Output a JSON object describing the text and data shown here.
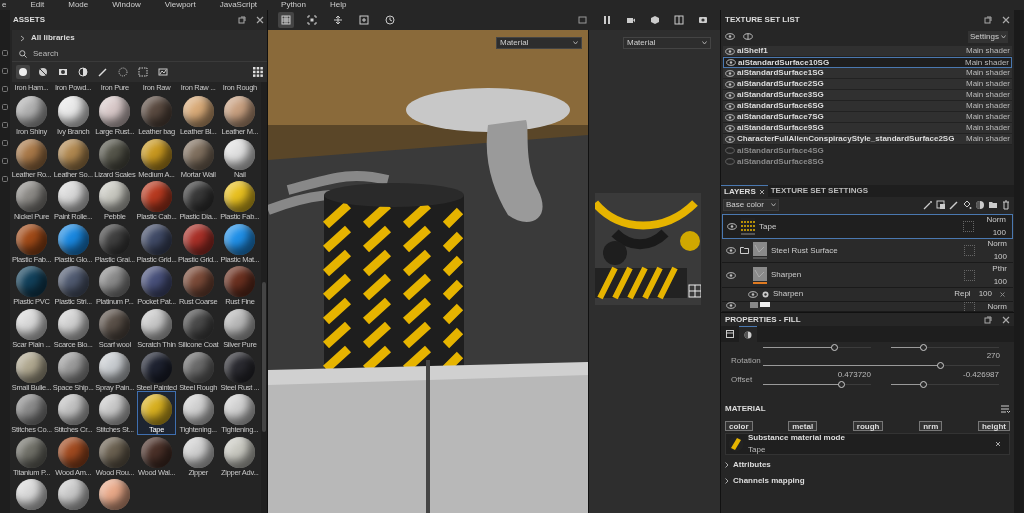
{
  "menu_bar": [
    "e",
    "Edit",
    "Mode",
    "Window",
    "Viewport",
    "JavaScript",
    "Python",
    "Help"
  ],
  "assets": {
    "title": "ASSETS",
    "library": "All libraries",
    "search": {
      "placeholder": "Search"
    },
    "filters": [
      {
        "selected": true
      },
      {
        "selected": false
      },
      {
        "selected": false
      },
      {
        "selected": false
      },
      {
        "selected": false
      },
      {
        "selected": false
      },
      {
        "selected": false
      },
      {
        "selected": false
      }
    ],
    "items": [
      {
        "name": "Iron Ham...",
        "selected": false
      },
      {
        "name": "Iron Powd...",
        "selected": false
      },
      {
        "name": "Iron Pure",
        "selected": false
      },
      {
        "name": "Iron Raw",
        "selected": false
      },
      {
        "name": "Iron Raw ...",
        "selected": false
      },
      {
        "name": "Iron Rough",
        "selected": false
      },
      {
        "name": "Iron Shiny",
        "color": "#b0b0b0",
        "selected": false
      },
      {
        "name": "Ivy Branch",
        "color": "#e8e8e8",
        "selected": false
      },
      {
        "name": "Large Rust...",
        "color": "#d8c8c8",
        "selected": false
      },
      {
        "name": "Leather bag",
        "color": "#5a4a40",
        "selected": false
      },
      {
        "name": "Leather Bl...",
        "color": "#d8aa78",
        "selected": false
      },
      {
        "name": "Leather M...",
        "color": "#c8a080",
        "selected": false
      },
      {
        "name": "Leather Ro...",
        "color": "#a87848",
        "selected": false
      },
      {
        "name": "Leather So...",
        "color": "#b08850",
        "selected": false
      },
      {
        "name": "Lizard Scales",
        "color": "#55554a",
        "selected": false
      },
      {
        "name": "Medium A...",
        "color": "#c89820",
        "selected": false
      },
      {
        "name": "Mortar Wall",
        "color": "#80705f",
        "selected": false
      },
      {
        "name": "Nail",
        "color": "#e0e0e0",
        "selected": false
      },
      {
        "name": "Nickel Pure",
        "color": "#8c8a86",
        "selected": false
      },
      {
        "name": "Paint Rolle...",
        "color": "#d8d8d8",
        "selected": false
      },
      {
        "name": "Pebble",
        "color": "#c8c8c0",
        "selected": false
      },
      {
        "name": "Plastic Cab...",
        "color": "#b83a20",
        "selected": false
      },
      {
        "name": "Plastic Dia...",
        "color": "#383838",
        "selected": false
      },
      {
        "name": "Plastic Fab...",
        "color": "#e8c020",
        "selected": false
      },
      {
        "name": "Plastic Fab...",
        "color": "#a04a18",
        "selected": false
      },
      {
        "name": "Plastic Glo...",
        "color": "#1a88e0",
        "selected": false
      },
      {
        "name": "Plastic Grai...",
        "color": "#404040",
        "selected": false
      },
      {
        "name": "Plastic Grid...",
        "color": "#404a66",
        "selected": false
      },
      {
        "name": "Plastic Grid...",
        "color": "#a83028",
        "selected": false
      },
      {
        "name": "Plastic Mat...",
        "color": "#2090e8",
        "selected": false
      },
      {
        "name": "Plastic PVC",
        "color": "#12405a",
        "selected": false
      },
      {
        "name": "Plastic Stri...",
        "color": "#505a70",
        "selected": false
      },
      {
        "name": "Platinum P...",
        "color": "#8a8a8a",
        "selected": false
      },
      {
        "name": "Pocket Pat...",
        "color": "#48507a",
        "selected": false
      },
      {
        "name": "Rust Coarse",
        "color": "#7a4a38",
        "selected": false
      },
      {
        "name": "Rust Fine",
        "color": "#6a3020",
        "selected": false
      },
      {
        "name": "Scar Plain ...",
        "color": "#d8d8d8",
        "selected": false
      },
      {
        "name": "Scarce Blo...",
        "color": "#d0d0d0",
        "selected": false
      },
      {
        "name": "Scarf wool",
        "color": "#5a5048",
        "selected": false
      },
      {
        "name": "Scratch Thin",
        "color": "#c8c8c8",
        "selected": false
      },
      {
        "name": "Silicone Coat",
        "color": "#4a4a4a",
        "selected": false
      },
      {
        "name": "Silver Pure",
        "color": "#b8b8b8",
        "selected": false
      },
      {
        "name": "Small Bulle...",
        "color": "#b0a890",
        "selected": false
      },
      {
        "name": "Space Ship...",
        "color": "#9a9a9a",
        "selected": false
      },
      {
        "name": "Spray Pain...",
        "color": "#c8ccd0",
        "selected": false
      },
      {
        "name": "Steel Painted",
        "color": "#1e2230",
        "selected": false
      },
      {
        "name": "Steel Rough",
        "color": "#6a6a6a",
        "selected": false
      },
      {
        "name": "Steel Rust ...",
        "color": "#2a2a30",
        "selected": false
      },
      {
        "name": "Stitches Co...",
        "color": "#8a8a8a",
        "selected": false
      },
      {
        "name": "Stitches Cr...",
        "color": "#c0c0c0",
        "selected": false
      },
      {
        "name": "Stitches St...",
        "color": "#c8c8c8",
        "selected": false
      },
      {
        "name": "Tape",
        "color": "#d8b020",
        "selected": true
      },
      {
        "name": "Tightening...",
        "color": "#d0d0d0",
        "selected": false
      },
      {
        "name": "Tightening...",
        "color": "#d0d0d0",
        "selected": false
      },
      {
        "name": "Titanium P...",
        "color": "#707068",
        "selected": false
      },
      {
        "name": "Wood Am...",
        "color": "#a04a20",
        "selected": false
      },
      {
        "name": "Wood Rou...",
        "color": "#6a6050",
        "selected": false
      },
      {
        "name": "Wood Wal...",
        "color": "#4a3028",
        "selected": false
      },
      {
        "name": "Zipper",
        "color": "#d0d0d0",
        "selected": false
      },
      {
        "name": "Zipper Adv...",
        "color": "#c8c8c0",
        "selected": false
      },
      {
        "color": "#d8d8d8",
        "selected": false
      },
      {
        "color": "#c8c8c8",
        "selected": false
      },
      {
        "color": "#e8a888",
        "selected": false
      }
    ]
  },
  "viewport": {
    "dropdowns": [
      "Material",
      "Material"
    ]
  },
  "texture_set_list": {
    "title": "TEXTURE SET LIST",
    "settings": "Settings",
    "items": [
      {
        "name": "aiShelf1",
        "shader": "Main shader",
        "visible": true,
        "selected": false
      },
      {
        "name": "aiStandardSurface10SG",
        "shader": "Main shader",
        "visible": true,
        "selected": true
      },
      {
        "name": "aiStandardSurface1SG",
        "shader": "Main shader",
        "visible": true,
        "selected": false
      },
      {
        "name": "aiStandardSurface2SG",
        "shader": "Main shader",
        "visible": true,
        "selected": false
      },
      {
        "name": "aiStandardSurface3SG",
        "shader": "Main shader",
        "visible": true,
        "selected": false
      },
      {
        "name": "aiStandardSurface6SG",
        "shader": "Main shader",
        "visible": true,
        "selected": false
      },
      {
        "name": "aiStandardSurface7SG",
        "shader": "Main shader",
        "visible": true,
        "selected": false
      },
      {
        "name": "aiStandardSurface9SG",
        "shader": "Main shader",
        "visible": true,
        "selected": false
      },
      {
        "name": "CharacterFullAlienConspiracyStyle_standardSurface2SG",
        "shader": "Main shader",
        "visible": true,
        "selected": false
      },
      {
        "name": "aiStandardSurface4SG",
        "visible": false,
        "selected": false
      },
      {
        "name": "aiStandardSurface8SG",
        "visible": false,
        "selected": false
      }
    ]
  },
  "layers": {
    "tabs": [
      {
        "label": "LAYERS",
        "selected": true
      },
      {
        "label": "TEXTURE SET SETTINGS",
        "selected": false
      }
    ],
    "channel": "Base color",
    "items": [
      {
        "kind": "fill",
        "name": "Tape",
        "blend": "Norm",
        "opacity": "100",
        "selected": true
      },
      {
        "kind": "folder",
        "name": "Steel Rust Surface",
        "blend": "Norm",
        "opacity": "100",
        "selected": false
      },
      {
        "kind": "fill",
        "name": "Sharpen",
        "blend": "Pthr",
        "opacity": "100",
        "selected": false
      },
      {
        "kind": "effect",
        "name": "Sharpen",
        "blend": "Repl",
        "opacity": "100",
        "selected": false
      },
      {
        "kind": "partial",
        "blend": "Norm",
        "selected": false
      }
    ]
  },
  "properties": {
    "title": "PROPERTIES - FILL",
    "tabs": [
      {
        "selected": false
      },
      {
        "selected": true
      }
    ],
    "sliders": [
      {
        "kind": "pair",
        "levels": [
          {
            "level": 0.66
          },
          {
            "level": 0.3
          }
        ]
      },
      {
        "kind": "single",
        "label": "Rotation",
        "reading": "270",
        "level": 0.75
      },
      {
        "kind": "pair",
        "label": "Offset",
        "readings": [
          "0.473720",
          "-0.426987"
        ],
        "levels": [
          {
            "level": 0.73
          },
          {
            "level": 0.3
          }
        ]
      }
    ],
    "material_title": "MATERIAL",
    "channels": [
      "color",
      "metal",
      "rough",
      "nrm",
      "height"
    ],
    "material": {
      "mode": "Substance material mode",
      "name": "Tape"
    },
    "sections": [
      "Attributes",
      "Channels mapping"
    ]
  }
}
